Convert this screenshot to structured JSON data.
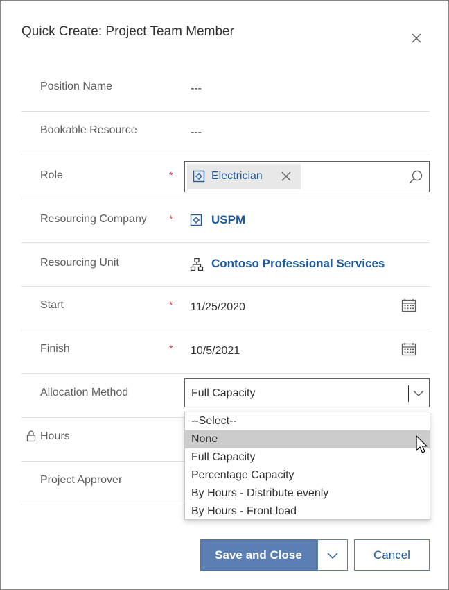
{
  "dialog": {
    "title": "Quick Create: Project Team Member",
    "close_icon": "close-icon"
  },
  "fields": {
    "position_name": {
      "label": "Position Name",
      "value": "---"
    },
    "bookable_resource": {
      "label": "Bookable Resource",
      "value": "---"
    },
    "role": {
      "label": "Role",
      "required": "*",
      "value": "Electrician"
    },
    "resourcing_company": {
      "label": "Resourcing Company",
      "required": "*",
      "value": "USPM"
    },
    "resourcing_unit": {
      "label": "Resourcing Unit",
      "value": "Contoso Professional Services"
    },
    "start": {
      "label": "Start",
      "required": "*",
      "value": "11/25/2020"
    },
    "finish": {
      "label": "Finish",
      "required": "*",
      "value": "10/5/2021"
    },
    "allocation_method": {
      "label": "Allocation Method",
      "value": "Full Capacity"
    },
    "hours": {
      "label": "Hours"
    },
    "project_approver": {
      "label": "Project Approver"
    }
  },
  "allocation_options": [
    "--Select--",
    "None",
    "Full Capacity",
    "Percentage Capacity",
    "By Hours - Distribute evenly",
    "By Hours - Front load"
  ],
  "highlighted_option": "None",
  "footer": {
    "save_label": "Save and Close",
    "cancel_label": "Cancel"
  },
  "colors": {
    "accent": "#5b7fb3",
    "link": "#1e5a9c",
    "required": "#d13438"
  }
}
